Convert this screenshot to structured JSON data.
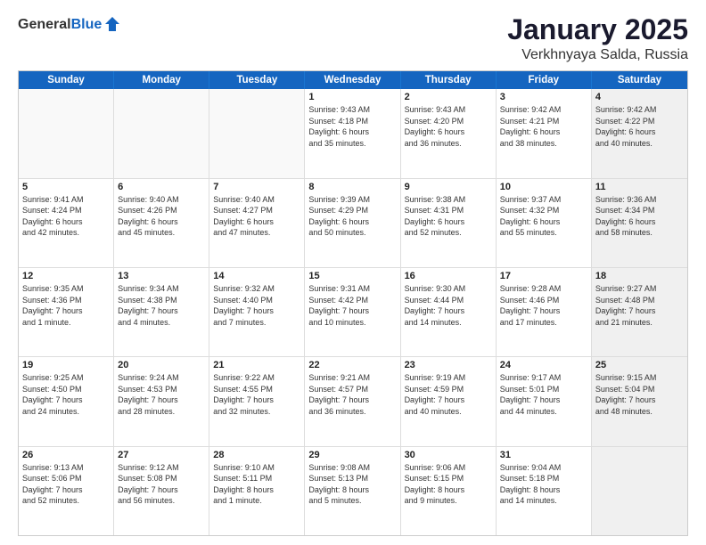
{
  "header": {
    "logo_general": "General",
    "logo_blue": "Blue",
    "month": "January 2025",
    "location": "Verkhnyaya Salda, Russia"
  },
  "weekdays": [
    "Sunday",
    "Monday",
    "Tuesday",
    "Wednesday",
    "Thursday",
    "Friday",
    "Saturday"
  ],
  "rows": [
    [
      {
        "day": "",
        "text": "",
        "empty": true
      },
      {
        "day": "",
        "text": "",
        "empty": true
      },
      {
        "day": "",
        "text": "",
        "empty": true
      },
      {
        "day": "1",
        "text": "Sunrise: 9:43 AM\nSunset: 4:18 PM\nDaylight: 6 hours\nand 35 minutes."
      },
      {
        "day": "2",
        "text": "Sunrise: 9:43 AM\nSunset: 4:20 PM\nDaylight: 6 hours\nand 36 minutes."
      },
      {
        "day": "3",
        "text": "Sunrise: 9:42 AM\nSunset: 4:21 PM\nDaylight: 6 hours\nand 38 minutes."
      },
      {
        "day": "4",
        "text": "Sunrise: 9:42 AM\nSunset: 4:22 PM\nDaylight: 6 hours\nand 40 minutes.",
        "shaded": true
      }
    ],
    [
      {
        "day": "5",
        "text": "Sunrise: 9:41 AM\nSunset: 4:24 PM\nDaylight: 6 hours\nand 42 minutes."
      },
      {
        "day": "6",
        "text": "Sunrise: 9:40 AM\nSunset: 4:26 PM\nDaylight: 6 hours\nand 45 minutes."
      },
      {
        "day": "7",
        "text": "Sunrise: 9:40 AM\nSunset: 4:27 PM\nDaylight: 6 hours\nand 47 minutes."
      },
      {
        "day": "8",
        "text": "Sunrise: 9:39 AM\nSunset: 4:29 PM\nDaylight: 6 hours\nand 50 minutes."
      },
      {
        "day": "9",
        "text": "Sunrise: 9:38 AM\nSunset: 4:31 PM\nDaylight: 6 hours\nand 52 minutes."
      },
      {
        "day": "10",
        "text": "Sunrise: 9:37 AM\nSunset: 4:32 PM\nDaylight: 6 hours\nand 55 minutes."
      },
      {
        "day": "11",
        "text": "Sunrise: 9:36 AM\nSunset: 4:34 PM\nDaylight: 6 hours\nand 58 minutes.",
        "shaded": true
      }
    ],
    [
      {
        "day": "12",
        "text": "Sunrise: 9:35 AM\nSunset: 4:36 PM\nDaylight: 7 hours\nand 1 minute."
      },
      {
        "day": "13",
        "text": "Sunrise: 9:34 AM\nSunset: 4:38 PM\nDaylight: 7 hours\nand 4 minutes."
      },
      {
        "day": "14",
        "text": "Sunrise: 9:32 AM\nSunset: 4:40 PM\nDaylight: 7 hours\nand 7 minutes."
      },
      {
        "day": "15",
        "text": "Sunrise: 9:31 AM\nSunset: 4:42 PM\nDaylight: 7 hours\nand 10 minutes."
      },
      {
        "day": "16",
        "text": "Sunrise: 9:30 AM\nSunset: 4:44 PM\nDaylight: 7 hours\nand 14 minutes."
      },
      {
        "day": "17",
        "text": "Sunrise: 9:28 AM\nSunset: 4:46 PM\nDaylight: 7 hours\nand 17 minutes."
      },
      {
        "day": "18",
        "text": "Sunrise: 9:27 AM\nSunset: 4:48 PM\nDaylight: 7 hours\nand 21 minutes.",
        "shaded": true
      }
    ],
    [
      {
        "day": "19",
        "text": "Sunrise: 9:25 AM\nSunset: 4:50 PM\nDaylight: 7 hours\nand 24 minutes."
      },
      {
        "day": "20",
        "text": "Sunrise: 9:24 AM\nSunset: 4:53 PM\nDaylight: 7 hours\nand 28 minutes."
      },
      {
        "day": "21",
        "text": "Sunrise: 9:22 AM\nSunset: 4:55 PM\nDaylight: 7 hours\nand 32 minutes."
      },
      {
        "day": "22",
        "text": "Sunrise: 9:21 AM\nSunset: 4:57 PM\nDaylight: 7 hours\nand 36 minutes."
      },
      {
        "day": "23",
        "text": "Sunrise: 9:19 AM\nSunset: 4:59 PM\nDaylight: 7 hours\nand 40 minutes."
      },
      {
        "day": "24",
        "text": "Sunrise: 9:17 AM\nSunset: 5:01 PM\nDaylight: 7 hours\nand 44 minutes."
      },
      {
        "day": "25",
        "text": "Sunrise: 9:15 AM\nSunset: 5:04 PM\nDaylight: 7 hours\nand 48 minutes.",
        "shaded": true
      }
    ],
    [
      {
        "day": "26",
        "text": "Sunrise: 9:13 AM\nSunset: 5:06 PM\nDaylight: 7 hours\nand 52 minutes."
      },
      {
        "day": "27",
        "text": "Sunrise: 9:12 AM\nSunset: 5:08 PM\nDaylight: 7 hours\nand 56 minutes."
      },
      {
        "day": "28",
        "text": "Sunrise: 9:10 AM\nSunset: 5:11 PM\nDaylight: 8 hours\nand 1 minute."
      },
      {
        "day": "29",
        "text": "Sunrise: 9:08 AM\nSunset: 5:13 PM\nDaylight: 8 hours\nand 5 minutes."
      },
      {
        "day": "30",
        "text": "Sunrise: 9:06 AM\nSunset: 5:15 PM\nDaylight: 8 hours\nand 9 minutes."
      },
      {
        "day": "31",
        "text": "Sunrise: 9:04 AM\nSunset: 5:18 PM\nDaylight: 8 hours\nand 14 minutes."
      },
      {
        "day": "",
        "text": "",
        "empty": true,
        "shaded": true
      }
    ]
  ]
}
